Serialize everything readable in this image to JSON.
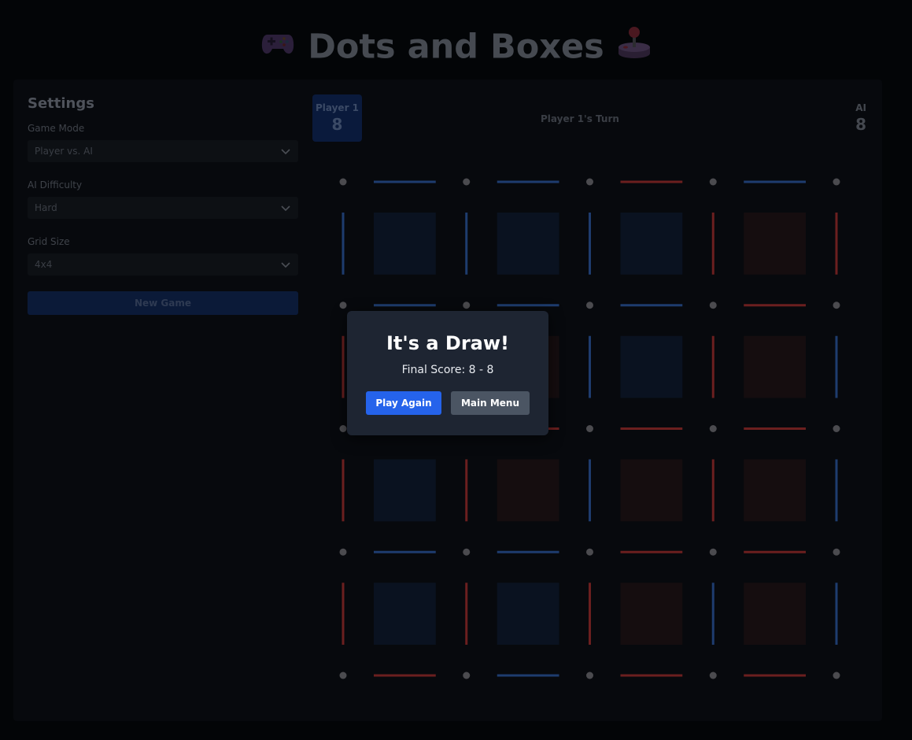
{
  "title": {
    "text": "Dots and Boxes",
    "left_icon": "game-controller-icon",
    "right_icon": "joystick-icon"
  },
  "settings": {
    "heading": "Settings",
    "game_mode": {
      "label": "Game Mode",
      "value": "Player vs. AI"
    },
    "ai_difficulty": {
      "label": "AI Difficulty",
      "value": "Hard"
    },
    "grid_size": {
      "label": "Grid Size",
      "value": "4x4"
    },
    "new_game_label": "New Game"
  },
  "scoreboard": {
    "player1": {
      "name": "Player 1",
      "score": "8"
    },
    "ai": {
      "name": "AI",
      "score": "8"
    },
    "turn_text": "Player 1's Turn"
  },
  "board": {
    "size": 4,
    "colors": {
      "dot": "#4b4b4f",
      "p1_line": "#1e3c6e",
      "ai_line": "#6b1f1f",
      "p1_box": "#0a1220",
      "ai_box": "#150d0f"
    },
    "h_lines": [
      [
        "p1",
        "p1",
        "ai",
        "p1"
      ],
      [
        "p1",
        "p1",
        "p1",
        "ai"
      ],
      [
        "ai",
        "ai",
        "ai",
        "ai"
      ],
      [
        "p1",
        "p1",
        "ai",
        "ai"
      ],
      [
        "ai",
        "p1",
        "ai",
        "ai"
      ]
    ],
    "v_lines": [
      [
        "p1",
        "p1",
        "p1",
        "ai",
        "ai"
      ],
      [
        "ai",
        "ai",
        "p1",
        "ai",
        "p1"
      ],
      [
        "ai",
        "ai",
        "p1",
        "ai",
        "p1"
      ],
      [
        "ai",
        "ai",
        "ai",
        "p1",
        "p1"
      ]
    ],
    "boxes": [
      [
        "p1",
        "p1",
        "p1",
        "ai"
      ],
      [
        "p1",
        "ai",
        "p1",
        "ai"
      ],
      [
        "p1",
        "ai",
        "ai",
        "ai"
      ],
      [
        "p1",
        "p1",
        "ai",
        "ai"
      ]
    ]
  },
  "modal": {
    "title": "It's a Draw!",
    "final_score": "Final Score: 8 - 8",
    "play_again_label": "Play Again",
    "main_menu_label": "Main Menu"
  }
}
